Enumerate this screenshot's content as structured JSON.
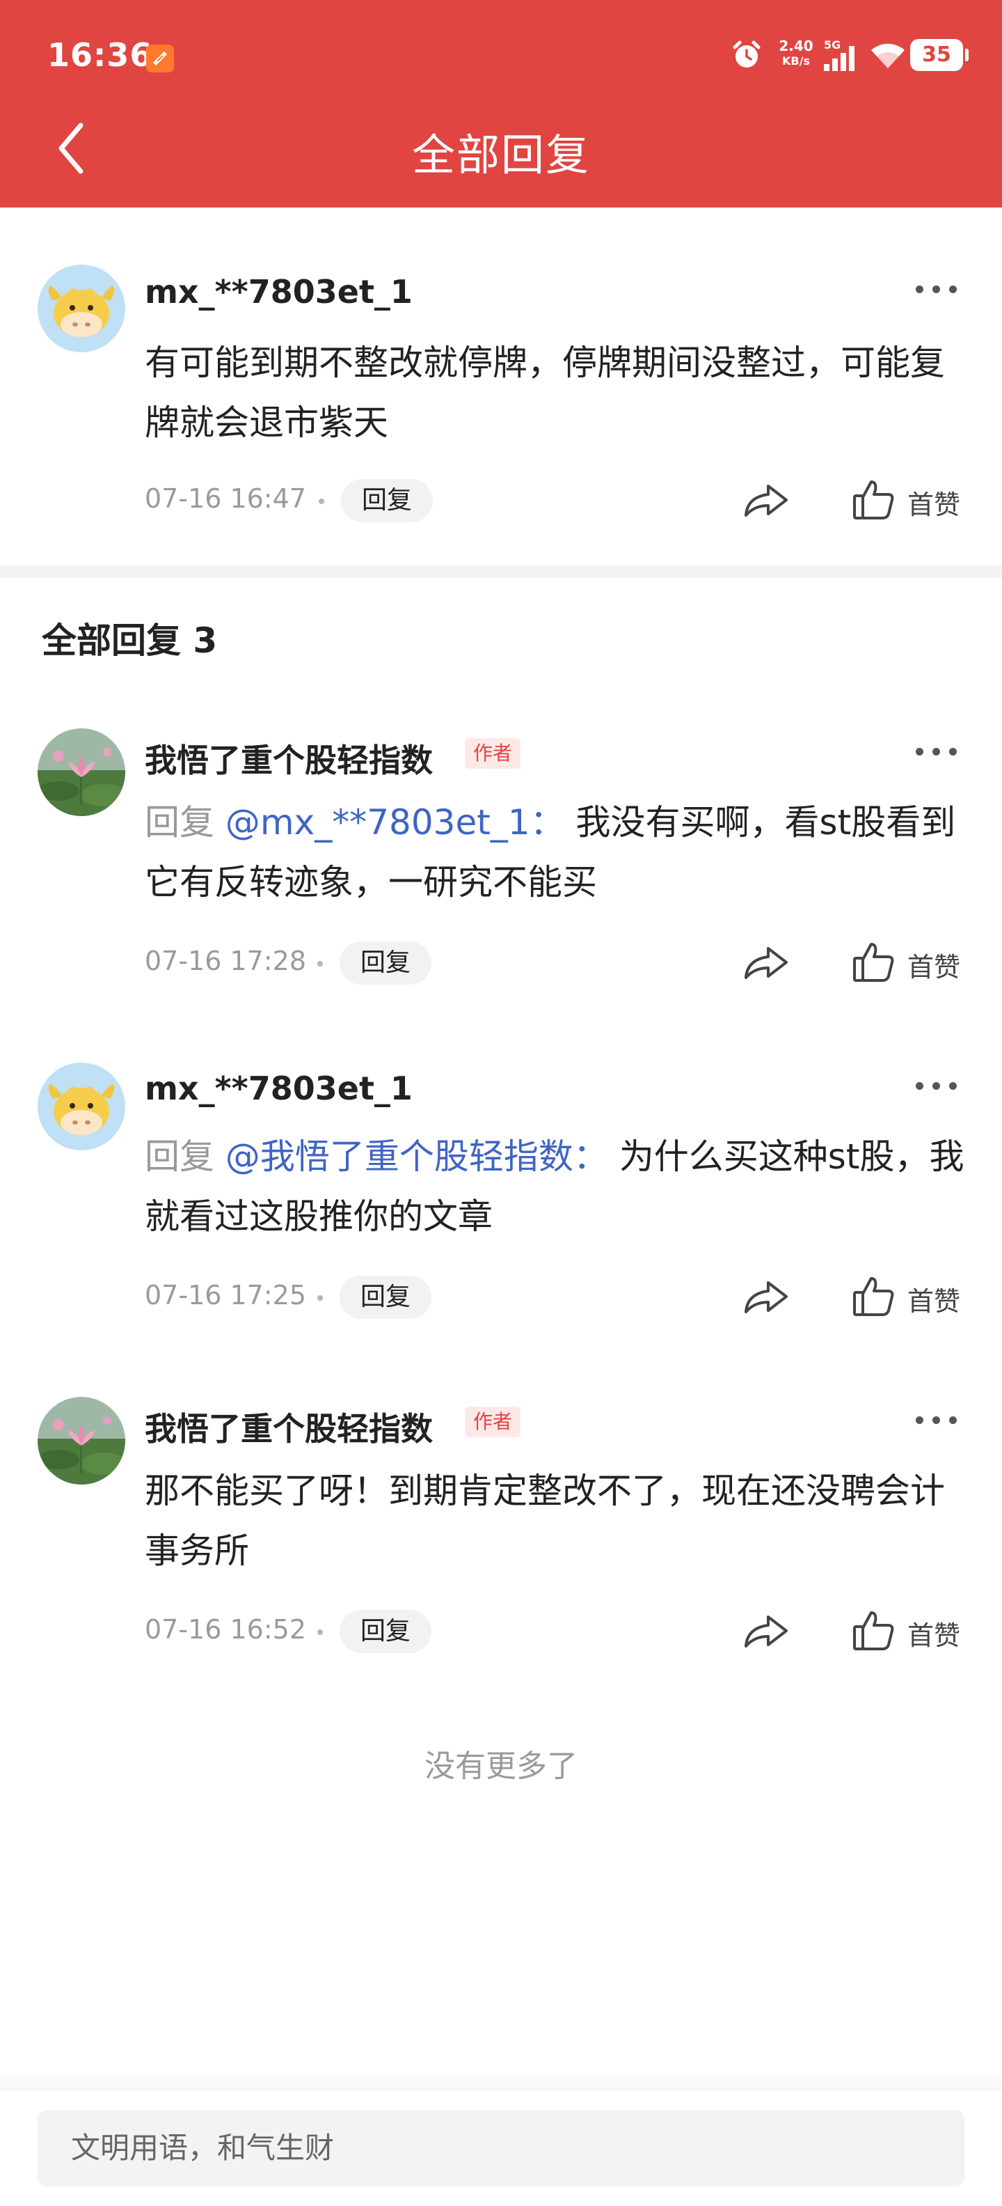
{
  "status_bar": {
    "time": "16:36",
    "net_speed_value": "2.40",
    "net_speed_unit": "KB/s",
    "network_type": "5G",
    "battery": "35"
  },
  "header": {
    "title": "全部回复",
    "background_color": "#e04542"
  },
  "main_comment": {
    "username": "mx_**7803et_1",
    "text": "有可能到期不整改就停牌，停牌期间没整过，可能复牌就会退市紫天",
    "time": "07-16 16:47",
    "reply_label": "回复",
    "like_label": "首赞",
    "avatar_icon": "cartoon-cow-avatar"
  },
  "replies_section": {
    "title": "全部回复 3"
  },
  "replies": [
    {
      "username": "我悟了重个股轻指数",
      "badge": "作者",
      "reply_prefix": "回复",
      "mention": "@mx_**7803et_1：",
      "text": "我没有买啊，看st股看到它有反转迹象，一研究不能买",
      "time": "07-16 17:28",
      "reply_label": "回复",
      "like_label": "首赞",
      "avatar_icon": "lotus-flower-avatar"
    },
    {
      "username": "mx_**7803et_1",
      "reply_prefix": "回复",
      "mention": "@我悟了重个股轻指数：",
      "text": "为什么买这种st股，我就看过这股推你的文章",
      "time": "07-16 17:25",
      "reply_label": "回复",
      "like_label": "首赞",
      "avatar_icon": "cartoon-cow-avatar"
    },
    {
      "username": "我悟了重个股轻指数",
      "badge": "作者",
      "text": "那不能买了呀！到期肯定整改不了，现在还没聘会计事务所",
      "time": "07-16 16:52",
      "reply_label": "回复",
      "like_label": "首赞",
      "avatar_icon": "lotus-flower-avatar"
    }
  ],
  "end_note": "没有更多了",
  "footer": {
    "input_placeholder": "文明用语，和气生财"
  },
  "colors": {
    "accent_red": "#e04542",
    "mention_blue": "#3f64c4",
    "muted_gray": "#9a9a9a"
  }
}
